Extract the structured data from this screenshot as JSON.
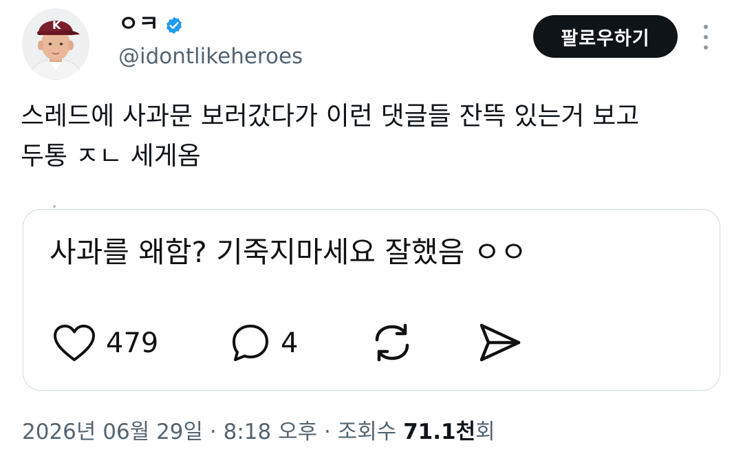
{
  "author": {
    "display_name": "ㅇㅋ",
    "handle": "@idontlikeheroes",
    "avatar_icon": "baseball-player-avatar",
    "verified_icon": "verified-badge-icon",
    "verified_color": "#1d9bf0"
  },
  "follow_button": {
    "label": "팔로우하기"
  },
  "more_icon": "more-vertical-icon",
  "tweet": {
    "text": "스레드에 사과문 보러갔다가 이런 댓글들 잔뜩 있는거 보고\n두통 ㅈㄴ 세게옴"
  },
  "embedded_post": {
    "text": "사과를 왜함? 기죽지마세요 잘했음 ㅇㅇ",
    "likes": "479",
    "replies": "4",
    "like_icon": "heart-icon",
    "reply_icon": "comment-bubble-icon",
    "repost_icon": "repost-icon",
    "share_icon": "send-icon"
  },
  "meta": {
    "timestamp": "2026년 06월 29일 · 8:18 오후 · 조회수 ",
    "views_number": "71.1천",
    "views_suffix": "회"
  },
  "colors": {
    "text": "#0f1419",
    "secondary": "#536471",
    "border": "#cfd9de",
    "button_bg": "#0f1419"
  }
}
